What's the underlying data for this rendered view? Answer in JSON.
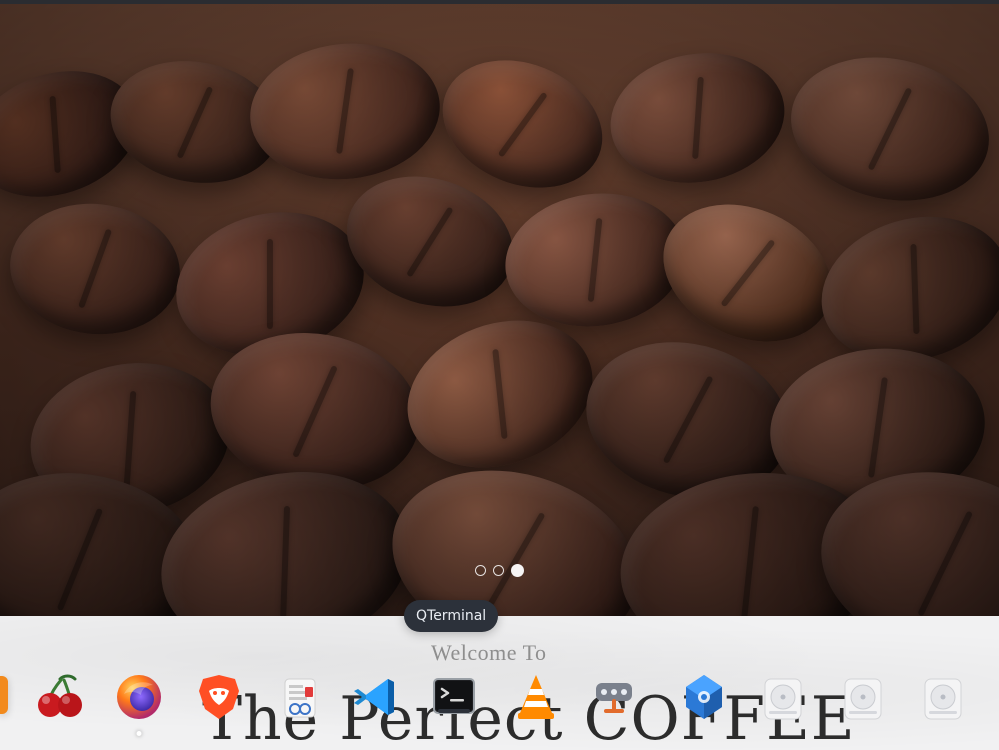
{
  "ui": {
    "tooltip": {
      "text": "QTerminal"
    },
    "page": {
      "welcome": "Welcome To",
      "headline": "The Perfect COFFEE"
    },
    "carousel": {
      "dots": [
        {
          "active": false
        },
        {
          "active": false
        },
        {
          "active": true
        }
      ]
    },
    "dock": {
      "items": [
        {
          "icon": "cherry-icon"
        },
        {
          "icon": "firefox-icon",
          "running": true
        },
        {
          "icon": "brave-icon"
        },
        {
          "icon": "document-viewer-icon"
        },
        {
          "icon": "vscode-icon"
        },
        {
          "icon": "terminal-icon",
          "tooltip_for": "QTerminal"
        },
        {
          "icon": "vlc-icon"
        },
        {
          "icon": "network-icon"
        },
        {
          "icon": "package-icon"
        },
        {
          "icon": "drive-icon"
        },
        {
          "icon": "drive-icon"
        },
        {
          "icon": "drive-icon"
        }
      ]
    }
  },
  "colors": {
    "tooltip_bg": "#2c313a",
    "page_bg": "#f1f1f2",
    "welcome_text": "#8e8e8e",
    "headline_text": "#2c2c2c"
  }
}
